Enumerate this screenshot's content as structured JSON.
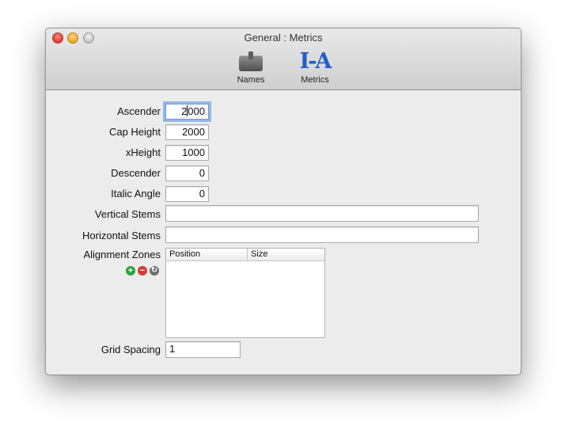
{
  "window": {
    "title": "General : Metrics"
  },
  "toolbar": {
    "names_label": "Names",
    "metrics_label": "Metrics",
    "metrics_glyph": "I-A",
    "metrics_color": "#1e5fc9"
  },
  "fields": {
    "ascender": {
      "label": "Ascender",
      "value_before_caret": "2",
      "value_after_caret": "000"
    },
    "cap_height": {
      "label": "Cap Height",
      "value": "2000"
    },
    "xheight": {
      "label": "xHeight",
      "value": "1000"
    },
    "descender": {
      "label": "Descender",
      "value": "0"
    },
    "italic_angle": {
      "label": "Italic Angle",
      "value": "0"
    },
    "vertical_stems": {
      "label": "Vertical Stems",
      "value": ""
    },
    "horizontal_stems": {
      "label": "Horizontal Stems",
      "value": ""
    },
    "grid_spacing": {
      "label": "Grid Spacing",
      "value": "1"
    }
  },
  "alignment_zones": {
    "label": "Alignment Zones",
    "columns": [
      "Position",
      "Size"
    ],
    "add_symbol": "+",
    "remove_symbol": "−",
    "refresh_symbol": "↻"
  }
}
